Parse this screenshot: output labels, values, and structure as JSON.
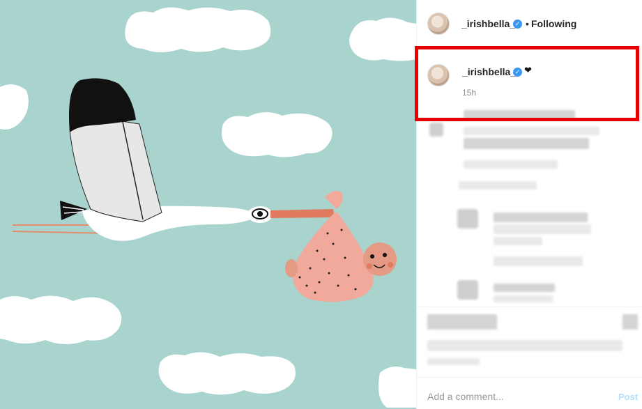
{
  "post": {
    "author": "_irishbella_",
    "follow_separator": "•",
    "follow_label": "Following",
    "verified_icon": "verified-badge-icon",
    "accent_color": "#3897f0"
  },
  "caption": {
    "author": "_irishbella_",
    "text": "❤",
    "time": "15h"
  },
  "comment_box": {
    "placeholder": "Add a comment...",
    "post_label": "Post"
  },
  "artwork": {
    "subject": "stork carrying a baby bundle among clouds",
    "background_color": "#a9d3cd"
  },
  "highlight_color": "#e90000"
}
